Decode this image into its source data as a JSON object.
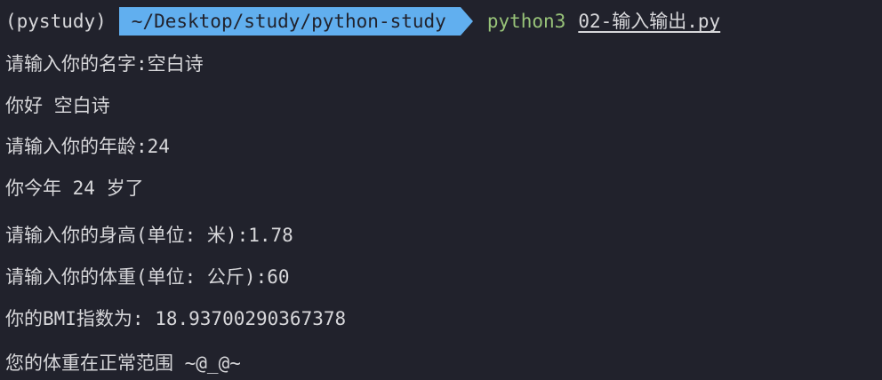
{
  "prompt": {
    "venv": "(pystudy)",
    "path": "~/Desktop/study/python-study",
    "command": "python3",
    "argument": "02-输入输出.py"
  },
  "output": [
    "请输入你的名字:空白诗",
    "你好 空白诗",
    "请输入你的年龄:24",
    "你今年 24 岁了",
    "请输入你的身高(单位: 米):1.78",
    "请输入你的体重(单位: 公斤):60",
    "你的BMI指数为: 18.93700290367378",
    "您的体重在正常范围 ~@_@~"
  ],
  "colors": {
    "background": "#21222c",
    "path_segment": "#61afef",
    "command": "#98c379",
    "text": "#d7d7da"
  }
}
